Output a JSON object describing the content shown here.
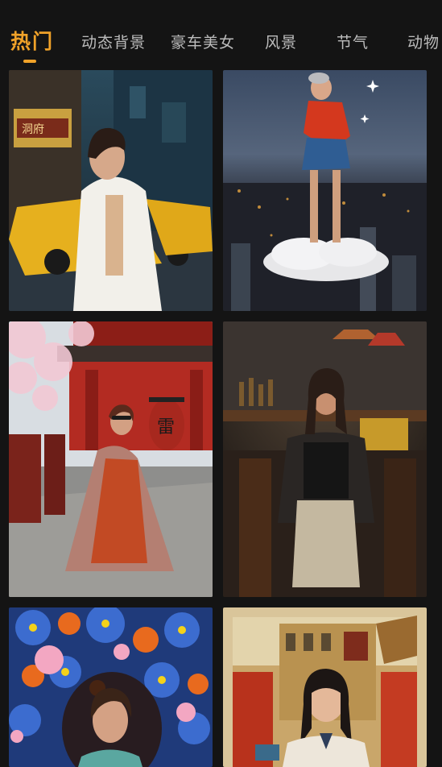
{
  "tabs": [
    {
      "label": "热门",
      "active": true
    },
    {
      "label": "动态背景",
      "active": false
    },
    {
      "label": "豪车美女",
      "active": false
    },
    {
      "label": "风景",
      "active": false
    },
    {
      "label": "节气",
      "active": false
    },
    {
      "label": "动物",
      "active": false
    }
  ],
  "colors": {
    "background": "#141414",
    "accent": "#f0a229",
    "tab_text": "#bdbdbd"
  },
  "tiles": [
    {
      "name": "tile-city-street-taxi-woman",
      "shop_sign": "洞府"
    },
    {
      "name": "tile-cloud-over-city-woman"
    },
    {
      "name": "tile-temple-cherry-blossom-woman",
      "lantern_text": "雷"
    },
    {
      "name": "tile-bar-interior-woman"
    },
    {
      "name": "tile-flower-mandala-woman"
    },
    {
      "name": "tile-old-town-schoolgirl"
    }
  ]
}
